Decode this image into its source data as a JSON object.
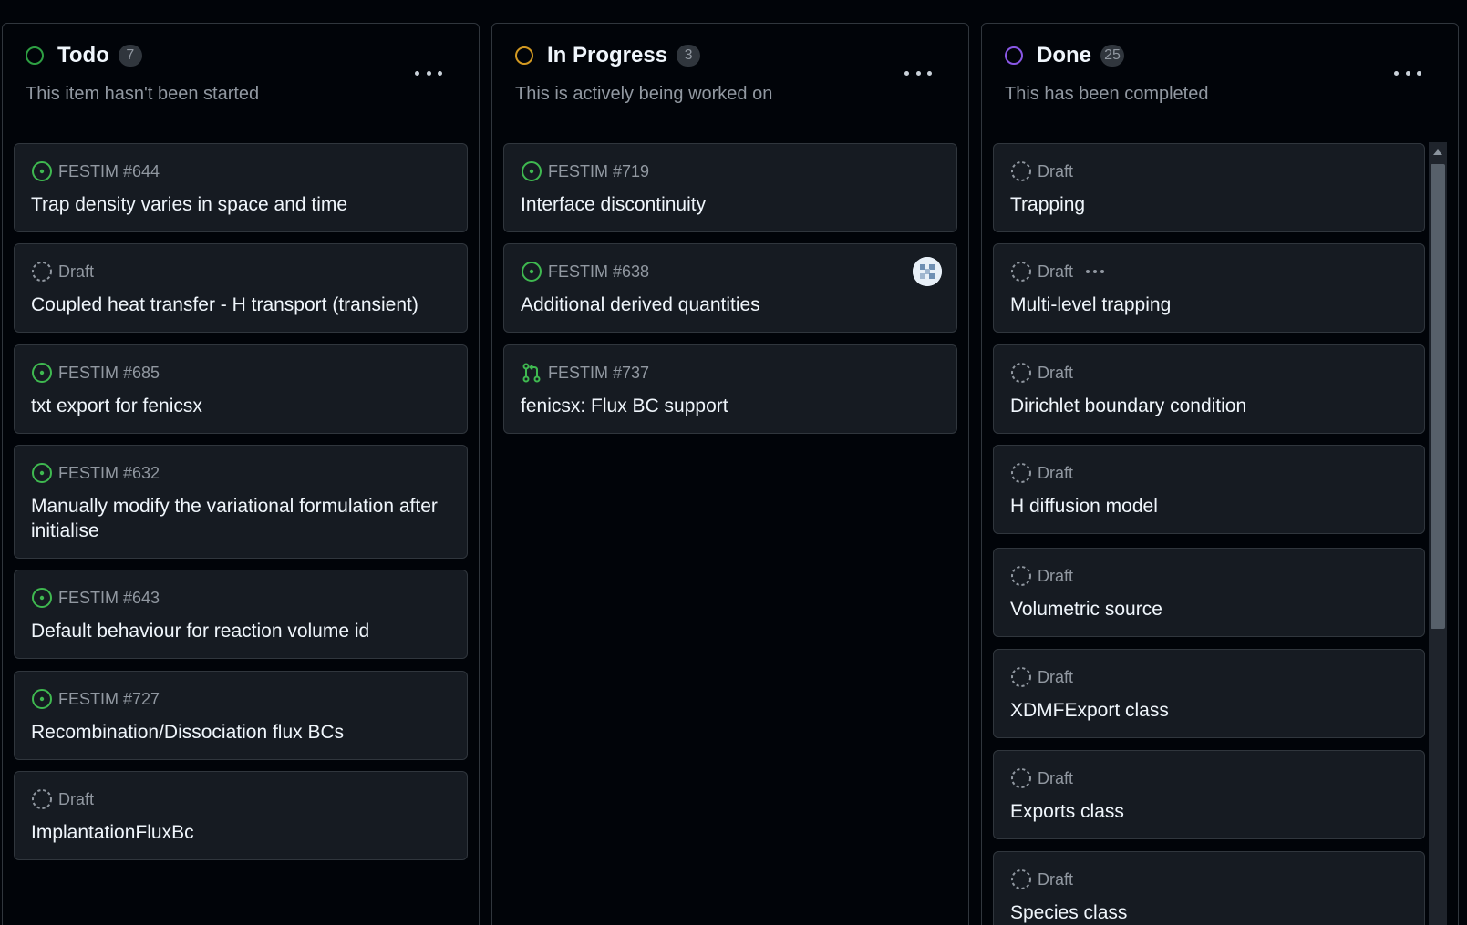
{
  "colors": {
    "todo": "#2ea043",
    "in_progress": "#d29922",
    "done": "#8957e5",
    "open_issue": "#3fb950",
    "draft": "#9198a1"
  },
  "columns": [
    {
      "title": "Todo",
      "count": "7",
      "description": "This item hasn't been started",
      "cards": [
        {
          "kind": "issue",
          "meta": "FESTIM #644",
          "title": "Trap density varies in space and time"
        },
        {
          "kind": "draft",
          "meta": "Draft",
          "title": "Coupled heat transfer - H transport (transient)"
        },
        {
          "kind": "issue",
          "meta": "FESTIM #685",
          "title": "txt export for fenicsx"
        },
        {
          "kind": "issue",
          "meta": "FESTIM #632",
          "title": "Manually modify the variational formulation after initialise"
        },
        {
          "kind": "issue",
          "meta": "FESTIM #643",
          "title": "Default behaviour for reaction volume id"
        },
        {
          "kind": "issue",
          "meta": "FESTIM #727",
          "title": "Recombination/Dissociation flux BCs"
        },
        {
          "kind": "draft",
          "meta": "Draft",
          "title": "ImplantationFluxBc"
        }
      ]
    },
    {
      "title": "In Progress",
      "count": "3",
      "description": "This is actively being worked on",
      "cards": [
        {
          "kind": "issue",
          "meta": "FESTIM #719",
          "title": "Interface discontinuity"
        },
        {
          "kind": "issue",
          "meta": "FESTIM #638",
          "title": "Additional derived quantities",
          "avatar": true
        },
        {
          "kind": "pr",
          "meta": "FESTIM #737",
          "title": "fenicsx: Flux BC support"
        }
      ]
    },
    {
      "title": "Done",
      "count": "25",
      "description": "This has been completed",
      "cards": [
        {
          "kind": "draft",
          "meta": "Draft",
          "title": "Trapping"
        },
        {
          "kind": "draft",
          "meta": "Draft",
          "title": "Multi-level trapping",
          "more": true
        },
        {
          "kind": "draft",
          "meta": "Draft",
          "title": "Dirichlet boundary condition"
        },
        {
          "kind": "draft",
          "meta": "Draft",
          "title": "H diffusion model"
        },
        {
          "kind": "draft",
          "meta": "Draft",
          "title": "Volumetric source"
        },
        {
          "kind": "draft",
          "meta": "Draft",
          "title": "XDMFExport class"
        },
        {
          "kind": "draft",
          "meta": "Draft",
          "title": "Exports class"
        },
        {
          "kind": "draft",
          "meta": "Draft",
          "title": "Species class"
        }
      ]
    }
  ]
}
